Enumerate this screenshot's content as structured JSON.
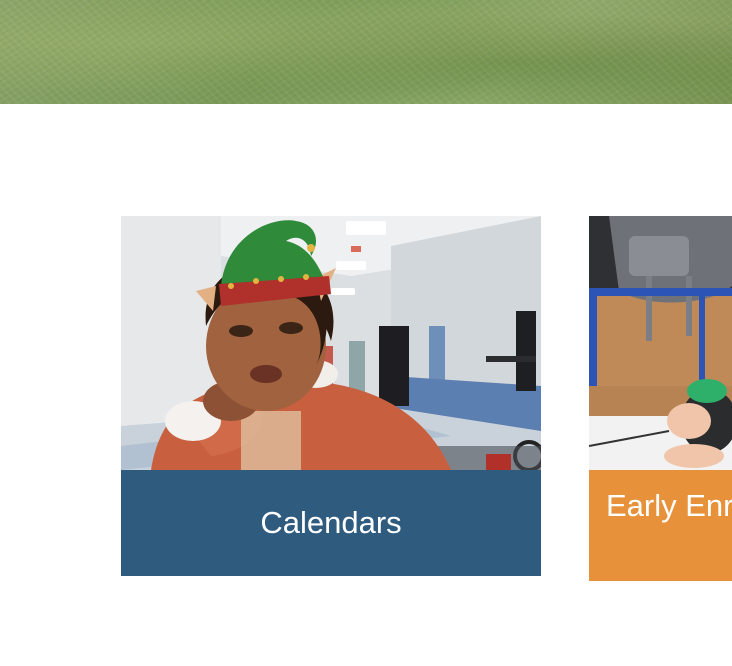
{
  "banner": {
    "color": "#7f9c5c"
  },
  "cards": [
    {
      "label": "Calendars",
      "color": "#2f5b7f",
      "photo_alt": "calendars-photo"
    },
    {
      "label": "Early Enrollment",
      "color": "#e8913b",
      "photo_alt": "early-enrollment-photo"
    }
  ]
}
